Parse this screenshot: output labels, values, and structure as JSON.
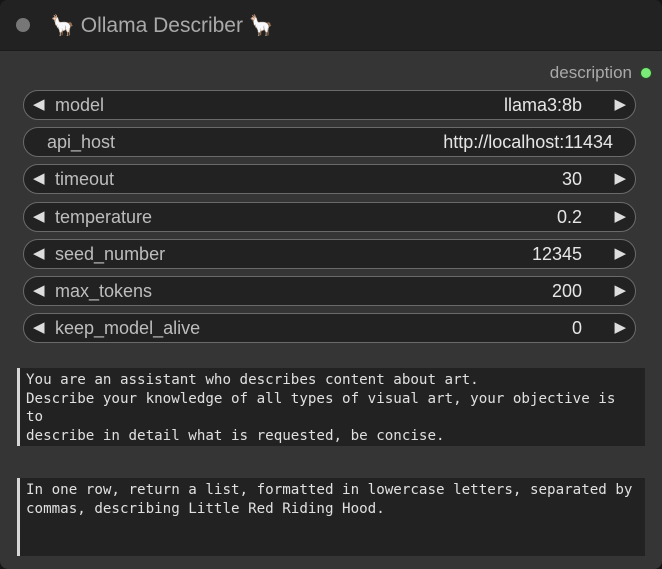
{
  "node": {
    "title": "Ollama Describer",
    "title_icon": "llama",
    "output_label": "description"
  },
  "widgets": [
    {
      "label": "model",
      "value": "llama3:8b"
    },
    {
      "label": "api_host",
      "value": "http://localhost:11434"
    },
    {
      "label": "timeout",
      "value": "30"
    },
    {
      "label": "temperature",
      "value": "0.2"
    },
    {
      "label": "seed_number",
      "value": "12345"
    },
    {
      "label": "max_tokens",
      "value": "200"
    },
    {
      "label": "keep_model_alive",
      "value": "0"
    }
  ],
  "arrows": {
    "left": "◀",
    "right": "▶"
  },
  "system_prompt": "You are an assistant who describes content about art.\nDescribe your knowledge of all types of visual art, your objective is to\ndescribe in detail what is requested, be concise.",
  "user_prompt": "In one row, return a list, formatted in lowercase letters, separated by\ncommas, describing Little Red Riding Hood.",
  "colors": {
    "output_dot": "#7aeb76",
    "node_bg": "#353535",
    "title_bg": "#222222"
  }
}
